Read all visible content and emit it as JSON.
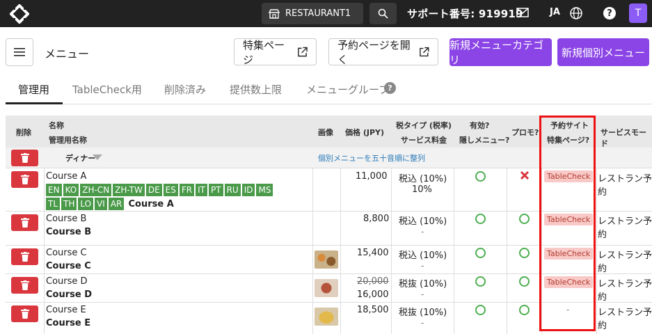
{
  "topbar": {
    "restaurant": "RESTAURANT1",
    "support": "サポート番号: 919919",
    "lang": "JA",
    "avatar_initial": "T"
  },
  "header": {
    "title": "メニュー",
    "feature_page": "特集ページ",
    "open_booking": "予約ページを開く",
    "new_category": "新規メニューカテゴリ",
    "new_item": "新規個別メニュー"
  },
  "tabs": [
    {
      "label": "管理用"
    },
    {
      "label": "TableCheck用"
    },
    {
      "label": "削除済み"
    },
    {
      "label": "提供数上限"
    },
    {
      "label": "メニューグループ"
    }
  ],
  "table": {
    "headers": {
      "delete": "削除",
      "name": "名称",
      "admin_name": "管理用名称",
      "image": "画像",
      "price": "価格 (JPY)",
      "tax_type": "税タイプ (税率)",
      "service_fee": "サービス料金",
      "enabled": "有効?",
      "hidden": "隠しメニュー?",
      "promo": "プロモ?",
      "booking_site": "予約サイト",
      "feature_page": "特集ページ?",
      "service_mode": "サービスモード"
    },
    "group": {
      "name": "ディナー",
      "sort_link": "個別メニューを五十音順に整列"
    },
    "rows": [
      {
        "name": "Course A",
        "admin": "Course A",
        "price": "11,000",
        "tax": "税込 (10%)",
        "fee": "10%",
        "site": "TableCheck",
        "mode1": "レストラン予",
        "mode2": "約",
        "langs": [
          "EN",
          "KO",
          "ZH-CN",
          "ZH-TW",
          "DE",
          "ES",
          "FR",
          "IT",
          "PT",
          "RU",
          "ID",
          "MS"
        ],
        "langs2": [
          "TL",
          "TH",
          "LO",
          "VI",
          "AR"
        ]
      },
      {
        "name": "Course B",
        "admin": "Course B",
        "price": "8,800",
        "tax": "税込 (10%)",
        "fee": "-",
        "site": "TableCheck",
        "mode1": "レストラン予",
        "mode2": "約"
      },
      {
        "name": "Course C",
        "admin": "Course C",
        "price": "15,400",
        "tax": "税込 (10%)",
        "fee": "-",
        "site": "TableCheck",
        "mode1": "レストラン予",
        "mode2": "約"
      },
      {
        "name": "Course D",
        "admin": "Course D",
        "old_price": "20,000",
        "price": "16,000",
        "tax": "税抜 (10%)",
        "fee": "-",
        "site": "TableCheck",
        "mode1": "レストラン予",
        "mode2": "約"
      },
      {
        "name": "Course E",
        "admin": "Course E",
        "price": "18,500",
        "tax": "税抜 (10%)",
        "fee": "-",
        "site": "-",
        "mode1": "レストラン予",
        "mode2": "約"
      }
    ]
  },
  "colors": {
    "accent": "#8b45e6",
    "danger": "#d9363e",
    "success": "#4caf50",
    "highlight": "#ee1111"
  }
}
